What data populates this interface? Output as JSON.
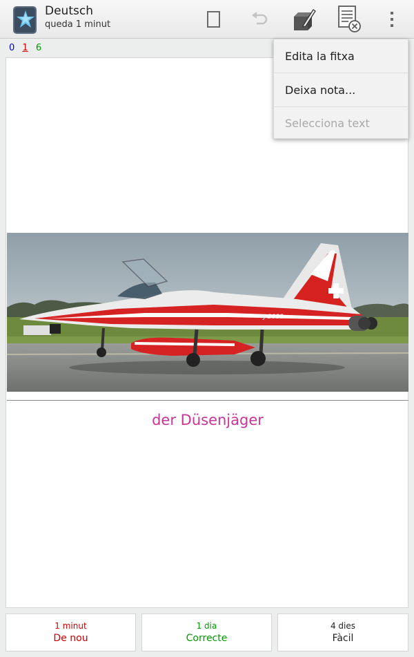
{
  "actionbar": {
    "title": "Deutsch",
    "subtitle": "queda 1 minut"
  },
  "counts": {
    "new": "0",
    "learning": "1",
    "review": "6"
  },
  "card": {
    "answer": "der Düsenjäger",
    "image": {
      "description_icon": "jet-fighter-image",
      "tail_code": "J-3088"
    }
  },
  "ease_buttons": [
    {
      "interval": "1 minut",
      "label": "De nou",
      "color": "#cc0000"
    },
    {
      "interval": "1 dia",
      "label": "Correcte",
      "color": "#009900"
    },
    {
      "interval": "4 dies",
      "label": "Fàcil",
      "color": "#222222"
    }
  ],
  "menu": {
    "items": [
      {
        "label": "Edita la fitxa",
        "enabled": true
      },
      {
        "label": "Deixa nota...",
        "enabled": true
      },
      {
        "label": "Selecciona text",
        "enabled": false
      }
    ]
  },
  "colors": {
    "answer_text": "#cc3399",
    "new_count": "#0000cc",
    "learning_count": "#cc0000",
    "review_count": "#009900"
  }
}
